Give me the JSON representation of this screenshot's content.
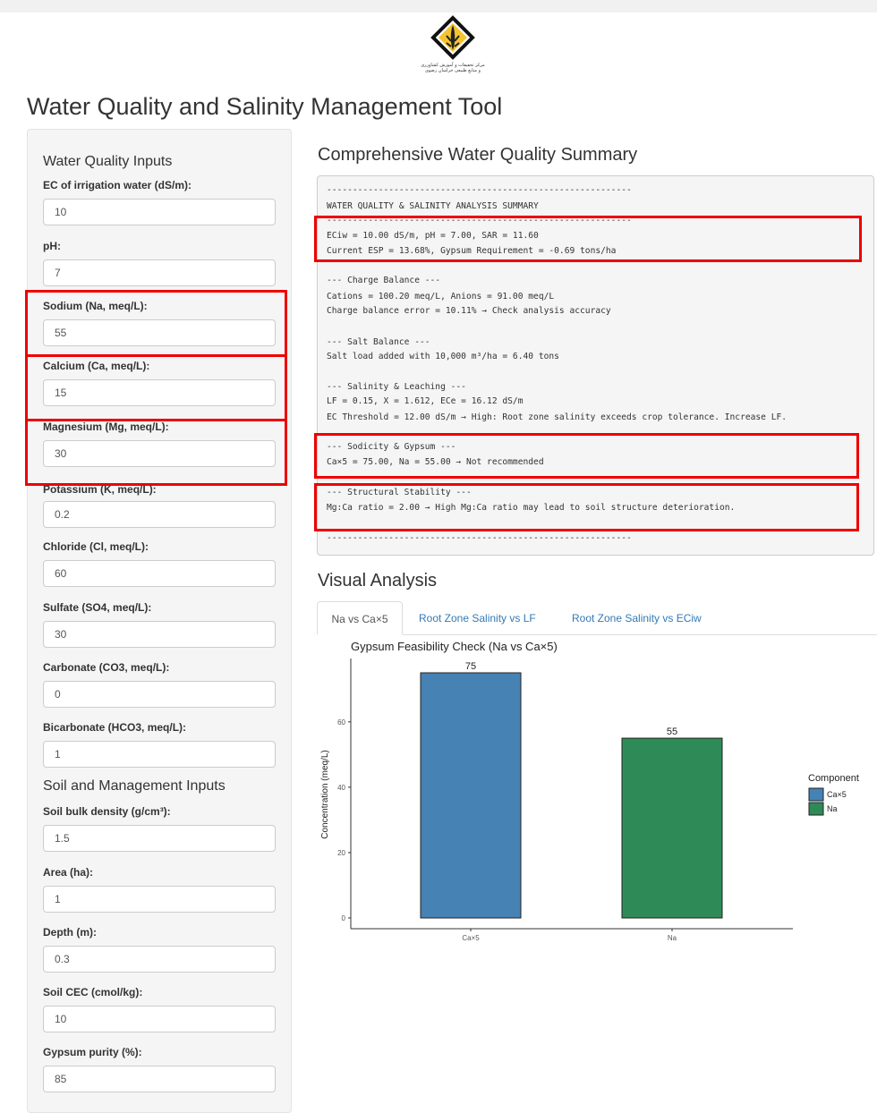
{
  "logo": {
    "name": "logo-icon",
    "caption_line1": "مرکز تحقیقات و آموزش کشاورزی",
    "caption_line2": "و منابع طبیعی خراسان رضوی"
  },
  "page_title": "Water Quality and Salinity Management Tool",
  "sidebar": {
    "water_section_title": "Water Quality Inputs",
    "soil_section_title": "Soil and Management Inputs",
    "water_fields": [
      {
        "label": "EC of irrigation water (dS/m):",
        "value": "10"
      },
      {
        "label": "pH:",
        "value": "7"
      },
      {
        "label": "Sodium (Na, meq/L):",
        "value": "55"
      },
      {
        "label": "Calcium (Ca, meq/L):",
        "value": "15"
      },
      {
        "label": "Magnesium (Mg, meq/L):",
        "value": "30"
      },
      {
        "label": "Potassium (K, meq/L):",
        "value": "0.2"
      },
      {
        "label": "Chloride (Cl, meq/L):",
        "value": "60"
      },
      {
        "label": "Sulfate (SO4, meq/L):",
        "value": "30"
      },
      {
        "label": "Carbonate (CO3, meq/L):",
        "value": "0"
      },
      {
        "label": "Bicarbonate (HCO3, meq/L):",
        "value": "1"
      }
    ],
    "soil_fields": [
      {
        "label": "Soil bulk density (g/cm³):",
        "value": "1.5"
      },
      {
        "label": "Area (ha):",
        "value": "1"
      },
      {
        "label": "Depth (m):",
        "value": "0.3"
      },
      {
        "label": "Soil CEC (cmol/kg):",
        "value": "10"
      },
      {
        "label": "Gypsum purity (%):",
        "value": "85"
      }
    ]
  },
  "summary": {
    "title": "Comprehensive Water Quality Summary",
    "rule": "-----------------------------------------------------------",
    "heading": "WATER QUALITY & SALINITY ANALYSIS SUMMARY",
    "line1": "ECiw = 10.00 dS/m, pH = 7.00, SAR = 11.60",
    "line2": "Current ESP = 13.68%, Gypsum Requirement = -0.69 tons/ha",
    "charge_header": "--- Charge Balance ---",
    "charge_1": "Cations = 100.20 meq/L, Anions = 91.00 meq/L",
    "charge_2": "Charge balance error = 10.11% → Check analysis accuracy",
    "salt_header": "--- Salt Balance ---",
    "salt_1": "Salt load added with 10,000 m³/ha = 6.40 tons",
    "leach_header": "--- Salinity & Leaching ---",
    "leach_1": "LF = 0.15, X = 1.612, ECe = 16.12 dS/m",
    "leach_2": "EC Threshold = 12.00 dS/m → High: Root zone salinity exceeds crop tolerance. Increase LF.",
    "sod_header": "--- Sodicity & Gypsum ---",
    "sod_1": "Ca×5 = 75.00, Na = 55.00 → Not recommended",
    "struct_header": "--- Structural Stability ---",
    "struct_1": "Mg:Ca ratio = 2.00 → High Mg:Ca ratio may lead to soil structure deterioration."
  },
  "visual": {
    "title": "Visual Analysis",
    "tabs": [
      "Na vs Ca×5",
      "Root Zone Salinity vs LF",
      "Root Zone Salinity vs ECiw"
    ],
    "active_tab": 0
  },
  "chart_data": {
    "type": "bar",
    "title": "Gypsum Feasibility Check (Na vs Ca×5)",
    "xlabel": "",
    "ylabel": "Concentration (meq/L)",
    "categories": [
      "Ca×5",
      "Na"
    ],
    "values": [
      75,
      55
    ],
    "colors": [
      "#4682b4",
      "#2e8b57"
    ],
    "yticks": [
      0,
      20,
      40,
      60
    ],
    "ylim": [
      0,
      78.75
    ],
    "grid": false,
    "legend_title": "Component",
    "legend_position": "right",
    "legend": [
      {
        "label": "Ca×5",
        "color": "#4682b4"
      },
      {
        "label": "Na",
        "color": "#2e8b57"
      }
    ]
  }
}
